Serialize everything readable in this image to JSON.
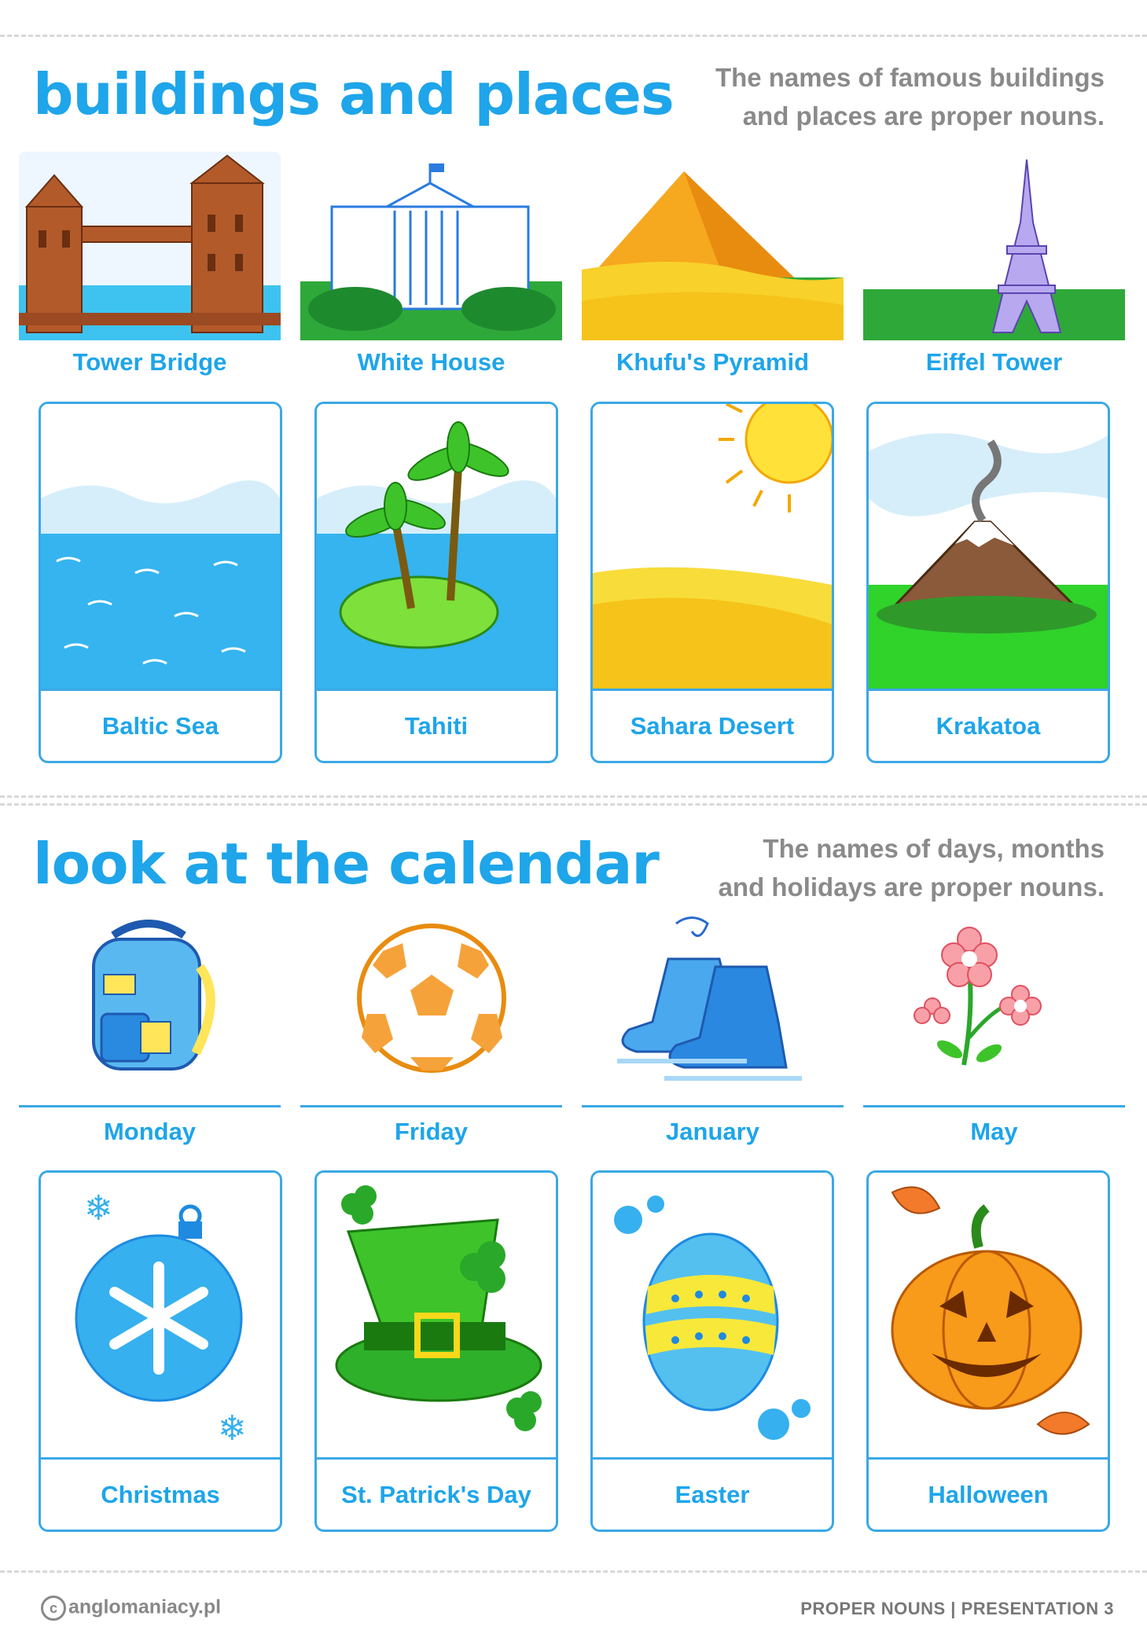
{
  "section1": {
    "title": "buildings and places",
    "description_line1": "The names of famous buildings",
    "description_line2": "and places are proper nouns."
  },
  "buildings": [
    {
      "label": "Tower Bridge",
      "icon": "tower-bridge-icon"
    },
    {
      "label": "White House",
      "icon": "white-house-icon"
    },
    {
      "label": "Khufu's Pyramid",
      "icon": "pyramid-icon"
    },
    {
      "label": "Eiffel Tower",
      "icon": "eiffel-tower-icon"
    }
  ],
  "places": [
    {
      "label": "Baltic Sea",
      "icon": "sea-icon"
    },
    {
      "label": "Tahiti",
      "icon": "island-icon"
    },
    {
      "label": "Sahara Desert",
      "icon": "desert-icon"
    },
    {
      "label": "Krakatoa",
      "icon": "volcano-icon"
    }
  ],
  "section2": {
    "title": "look at the calendar",
    "description_line1": "The names of days, months",
    "description_line2": "and holidays are proper nouns."
  },
  "calendar": [
    {
      "label": "Monday",
      "icon": "backpack-icon"
    },
    {
      "label": "Friday",
      "icon": "soccer-ball-icon"
    },
    {
      "label": "January",
      "icon": "ice-skates-icon"
    },
    {
      "label": "May",
      "icon": "flower-icon"
    }
  ],
  "holidays": [
    {
      "label": "Christmas",
      "icon": "christmas-ornament-icon"
    },
    {
      "label": "St. Patrick's Day",
      "icon": "leprechaun-hat-icon"
    },
    {
      "label": "Easter",
      "icon": "easter-egg-icon"
    },
    {
      "label": "Halloween",
      "icon": "pumpkin-icon"
    }
  ],
  "footer": {
    "copyright_symbol": "c",
    "site": "anglomaniacy.pl",
    "right": "PROPER NOUNS  |  PRESENTATION 3"
  },
  "colors": {
    "accent": "#1ea5ea",
    "text_gray": "#8a8a8a",
    "border": "#3aa8e6"
  }
}
